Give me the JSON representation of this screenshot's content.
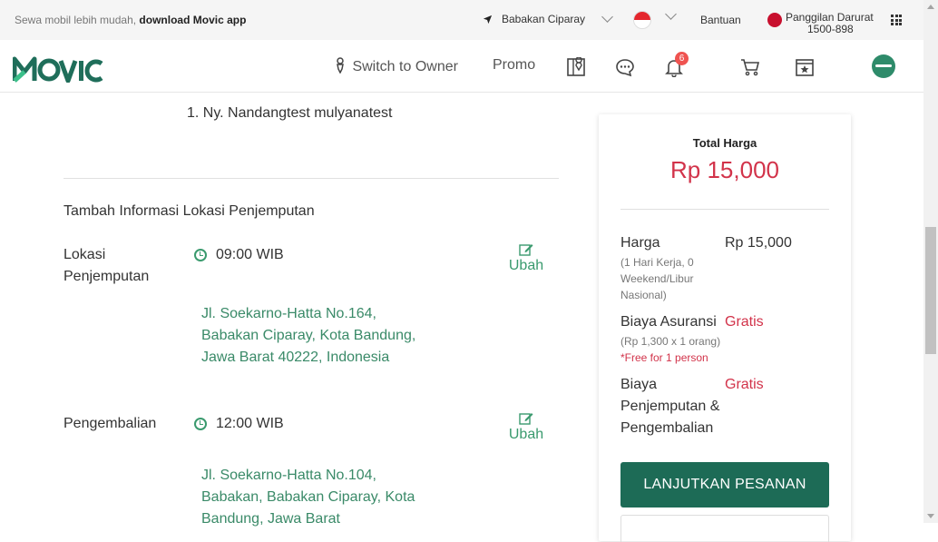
{
  "topbar": {
    "promo_text": "Sewa mobil lebih mudah,",
    "promo_link": "download Movic app",
    "location": "Babakan Ciparay",
    "help": "Bantuan",
    "emergency_label": "Panggilan Darurat",
    "emergency_number": "1500-898"
  },
  "navbar": {
    "logo": "MOVIC",
    "switch_owner": "Switch to Owner",
    "promo": "Promo",
    "notification_count": "6"
  },
  "booking": {
    "passenger": "1. Ny. Nandangtest mulyanatest",
    "section_title": "Tambah Informasi Lokasi Penjemputan",
    "pickup": {
      "label": "Lokasi Penjemputan",
      "time": "09:00 WIB",
      "edit_label": "Ubah",
      "address": "Jl. Soekarno-Hatta No.164, Babakan Ciparay, Kota Bandung, Jawa Barat 40222, Indonesia"
    },
    "return": {
      "label": "Pengembalian",
      "time": "12:00 WIB",
      "edit_label": "Ubah",
      "address": "Jl. Soekarno-Hatta No.104, Babakan, Babakan Ciparay, Kota Bandung, Jawa Barat"
    }
  },
  "summary": {
    "total_label": "Total Harga",
    "total_value": "Rp 15,000",
    "price_label": "Harga",
    "price_value": "Rp 15,000",
    "price_detail": "(1 Hari Kerja, 0 Weekend/Libur Nasional)",
    "insurance_label": "Biaya Asuransi",
    "insurance_value": "Gratis",
    "insurance_detail": "(Rp 1,300 x 1 orang)",
    "insurance_note": "*Free for 1 person",
    "pickup_fee_label": "Biaya Penjemputan & Pengembalian",
    "pickup_fee_value": "Gratis",
    "cta_label": "LANJUTKAN PESANAN"
  },
  "colors": {
    "brand_green": "#1d6b56",
    "accent_green": "#3a8a68",
    "price_red": "#d2334a"
  }
}
